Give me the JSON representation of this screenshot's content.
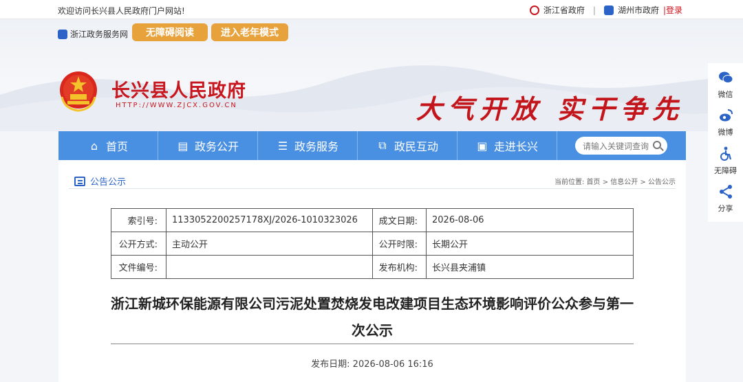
{
  "topbar": {
    "welcome": "欢迎访问长兴县人民政府门户网站!",
    "link1": "浙江省政府",
    "separator": "|",
    "link2": "湖州市政府",
    "login": "|登录"
  },
  "header": {
    "service_link": "浙江政务服务网",
    "accessible_btn": "无障碍阅读",
    "elder_btn": "进入老年模式",
    "site_name": "长兴县人民政府",
    "site_url": "HTTP://WWW.ZJCX.GOV.CN",
    "slogan": "大气开放 实干争先"
  },
  "nav": {
    "items": [
      {
        "label": "首页",
        "icon": "home-icon"
      },
      {
        "label": "政务公开",
        "icon": "doc-icon"
      },
      {
        "label": "政务服务",
        "icon": "list-icon"
      },
      {
        "label": "政民互动",
        "icon": "interact-icon"
      },
      {
        "label": "走进长兴",
        "icon": "image-icon"
      }
    ],
    "search_placeholder": "请输入关键词查询"
  },
  "breadcrumb": {
    "section": "公告公示",
    "path": "当前位置: 首页 > 信息公开 > 公告公示"
  },
  "info_table": {
    "rows": [
      {
        "label1": "索引号:",
        "value1": "1133052200257178XJ/2026-1010323026",
        "label2": "成文日期:",
        "value2": "2026-08-06"
      },
      {
        "label1": "公开方式:",
        "value1": "主动公开",
        "label2": "公开时限:",
        "value2": "长期公开"
      },
      {
        "label1": "文件编号:",
        "value1": "",
        "label2": "发布机构:",
        "value2": "长兴县夹浦镇"
      }
    ]
  },
  "article": {
    "title": "浙江新城环保能源有限公司污泥处置焚烧发电改建项目生态环境影响评价公众参与第一次公示",
    "publish_date": "发布日期: 2026-08-06 16:16"
  },
  "sidebar": {
    "items": [
      {
        "label": "微信",
        "icon": "wechat-icon"
      },
      {
        "label": "微博",
        "icon": "weibo-icon"
      },
      {
        "label": "无障碍",
        "icon": "accessibility-icon"
      },
      {
        "label": "分享",
        "icon": "share-icon"
      }
    ]
  },
  "colors": {
    "nav_blue": "#4a90e2",
    "brand_red": "#c7161d",
    "pill_orange": "#e8a23b"
  }
}
